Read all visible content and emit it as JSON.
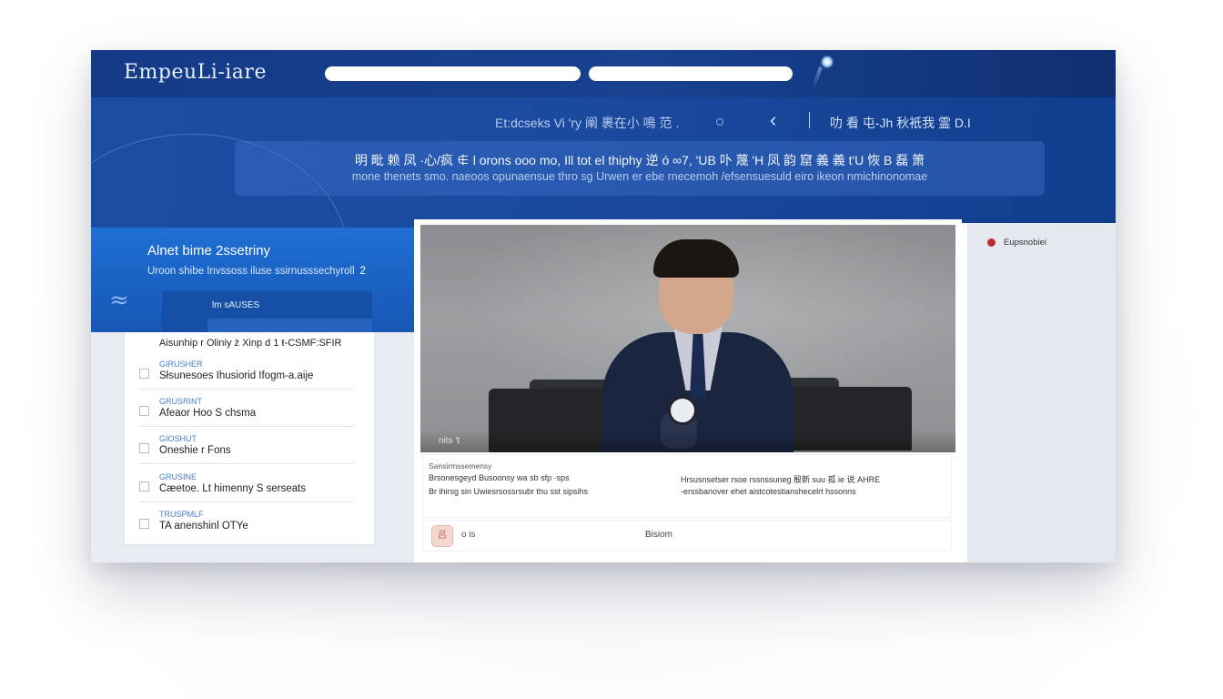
{
  "topbar": {
    "brand": "EmpeuLi-iare"
  },
  "hero": {
    "nav_text": "Et:dcseks Vi 'ry 阐 裹在小 鳴 范 .",
    "right_text": "叻 看 屯-Jh 秋衹我 霊 D.I",
    "banner_line1": "明 毗 赖 凤 ·心/疯 ∉ l orons ooo mo, Ill tot el thiphy 逆 ó ∞7, 'UB 卟 蔑 'H 凤 韵 窟 義 義 t'U 恢 B 磊 箫",
    "banner_line2": "mone thenets smo. naeoos opunaensue thro sg Urwen er ebe rnecemoh /efsensuesuld eiro ikeon nmichinonomae"
  },
  "left": {
    "title": "Alnet bime 2ssetriny",
    "subtitle": "Uroon shibe Invssoss iluse ssirnusssechyroll",
    "subtitle_num": "2",
    "tab_label": "lm sAUSES",
    "first_item": "Aisunhip r Oliniy ż Xinp d 1 ŧ-CSMF:SFIR",
    "items": [
      {
        "category": "GIRUSHER",
        "title": "Słsunesoes Ihusiorid Ifogm-a.aije"
      },
      {
        "category": "GRUSRINT",
        "title": "Afeaor Hoo S chsma"
      },
      {
        "category": "GIOSHUT",
        "title": "Oneshie r Fons"
      },
      {
        "category": "GRUSINE",
        "title": "Cæetoe. Lt himenny S serseats"
      },
      {
        "category": "TRUSPMLF",
        "title": "TA anenshinl OTYe"
      }
    ]
  },
  "video": {
    "tag": "nits 't",
    "caption_small": "Sansirmssemensy",
    "caption_l1": "Brsonesgeyd Busoonsy wa sb sfp ·sps",
    "caption_l2": "Br ihirsg sin Uwiesrsossrsubr thu sst sipsihs",
    "caption_r1": "Hrsusnsetser rsoe rssnssuneg 殷新 suu 孤 ie 说 AHRE",
    "caption_r2": "-erssbanover ehet aistcotestianshecelrt hssonns",
    "footer_logo": "吕",
    "footer_count": "o is",
    "footer_label": "Bisiom"
  },
  "right": {
    "status_label": "Eupsnobiei",
    "status_color": "#b72d2d"
  }
}
